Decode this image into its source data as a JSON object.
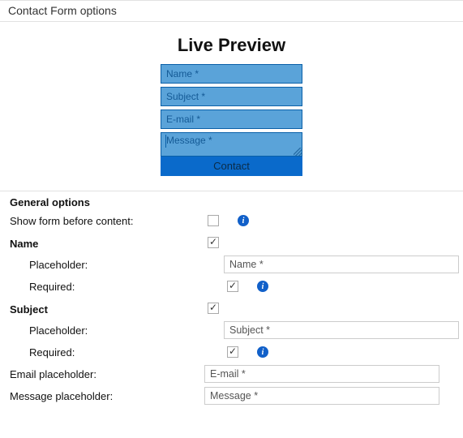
{
  "header": {
    "title": "Contact Form options"
  },
  "preview": {
    "title": "Live Preview",
    "name_placeholder": "Name *",
    "subject_placeholder": "Subject *",
    "email_placeholder": "E-mail *",
    "message_placeholder": "Message *",
    "submit_label": "Contact"
  },
  "options": {
    "general_heading": "General options",
    "show_before_content": {
      "label": "Show form before content:",
      "checked": false
    },
    "name": {
      "heading": "Name",
      "enabled": true,
      "placeholder_label": "Placeholder:",
      "placeholder_value": "Name *",
      "required_label": "Required:",
      "required_checked": true
    },
    "subject": {
      "heading": "Subject",
      "enabled": true,
      "placeholder_label": "Placeholder:",
      "placeholder_value": "Subject *",
      "required_label": "Required:",
      "required_checked": true
    },
    "email_placeholder": {
      "label": "Email placeholder:",
      "value": "E-mail *"
    },
    "message_placeholder": {
      "label": "Message placeholder:",
      "value": "Message *"
    },
    "info_glyph": "i"
  }
}
